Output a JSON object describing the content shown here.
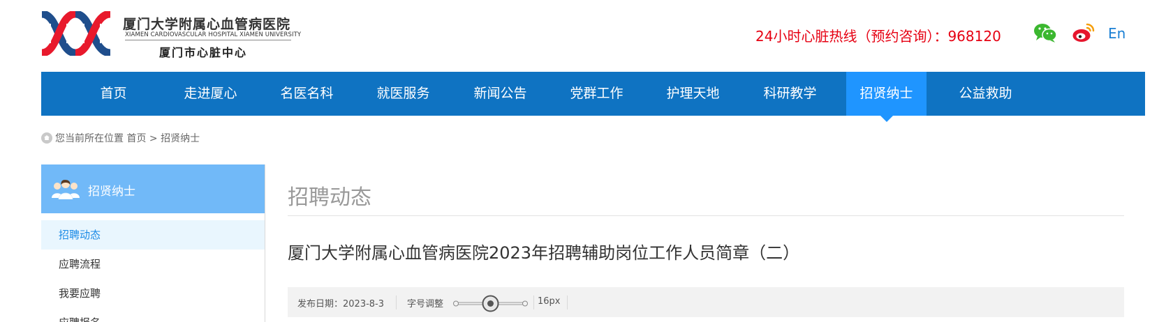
{
  "header": {
    "logo_cn": "厦门大学附属心血管病医院",
    "logo_en": "XIAMEN CARDIOVASCULAR HOSPITAL XIAMEN UNIVERSITY",
    "logo_sub": "厦门市心脏中心",
    "hotline": "24小时心脏热线（预约咨询）：968120",
    "icons": [
      "wechat-icon",
      "weibo-icon"
    ],
    "lang": "En"
  },
  "nav": {
    "items": [
      {
        "label": "首页"
      },
      {
        "label": "走进厦心"
      },
      {
        "label": "名医名科"
      },
      {
        "label": "就医服务"
      },
      {
        "label": "新闻公告"
      },
      {
        "label": "党群工作"
      },
      {
        "label": "护理天地"
      },
      {
        "label": "科研教学"
      },
      {
        "label": "招贤纳士",
        "active": true
      },
      {
        "label": "公益救助"
      }
    ]
  },
  "breadcrumb": {
    "prefix": "您当前所在位置",
    "home": "首页",
    "separator": ">",
    "current": "招贤纳士"
  },
  "sidebar": {
    "title": "招贤纳士",
    "items": [
      {
        "label": "招聘动态",
        "active": true
      },
      {
        "label": "应聘流程"
      },
      {
        "label": "我要应聘"
      },
      {
        "label": "应聘报名"
      }
    ]
  },
  "main": {
    "section_title": "招聘动态",
    "article_title": "厦门大学附属心血管病医院2023年招聘辅助岗位工作人员简章（二）",
    "meta": {
      "date_label": "发布日期：",
      "date": "2023-8-3",
      "font_label": "字号调整",
      "font_size": "16px",
      "font_slider_level": 0.5
    }
  },
  "colors": {
    "nav_bg": "#0f73c2",
    "nav_active": "#1f95ff",
    "hotline": "#e60012",
    "sidebar_head": "#71b9f8",
    "sidebar_active_bg": "#e9f6fe",
    "sidebar_active_text": "#1a8ae6",
    "logo_red": "#e8192c",
    "logo_blue": "#1f4e8c"
  }
}
